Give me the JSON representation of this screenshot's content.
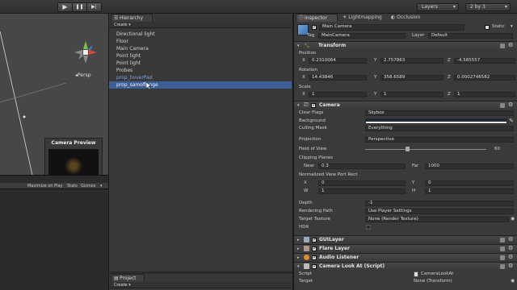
{
  "toolbar": {
    "play": "▶",
    "pause": "❚❚",
    "step": "▶|",
    "layers": "Layers",
    "layout": "2 by 3"
  },
  "scene": {
    "persp": "Persp",
    "camera_preview_title": "Camera Preview"
  },
  "game": {
    "maximize": "Maximize on Play",
    "stats": "Stats",
    "gizmos": "Gizmos"
  },
  "hierarchy": {
    "tab": "Hierarchy",
    "create": "Create",
    "items": [
      {
        "label": "Directional light"
      },
      {
        "label": "Floor"
      },
      {
        "label": "Main Camera"
      },
      {
        "label": "Point light"
      },
      {
        "label": "Point light"
      },
      {
        "label": "Probes"
      },
      {
        "label": "prop_hoverPad"
      },
      {
        "label": "prop_samoflange"
      }
    ]
  },
  "project": {
    "tab": "Project",
    "create": "Create"
  },
  "inspector": {
    "tabs": [
      "Inspector",
      "Lightmapping",
      "Occlusion"
    ],
    "object_name": "Main Camera",
    "static": "Static",
    "tag_label": "Tag",
    "tag_value": "MainCamera",
    "layer_label": "Layer",
    "layer_value": "Default",
    "transform": {
      "title": "Transform",
      "position": "Position",
      "rotation": "Rotation",
      "scale": "Scale",
      "pos": {
        "x": "0.2310064",
        "y": "2.757863",
        "z": "-4.585557"
      },
      "rot": {
        "x": "14.43846",
        "y": "358.6589",
        "z": "0.0002746582"
      },
      "scl": {
        "x": "1",
        "y": "1",
        "z": "1"
      },
      "x": "X",
      "y": "Y",
      "z": "Z"
    },
    "camera": {
      "title": "Camera",
      "clear_flags": "Clear Flags",
      "clear_flags_value": "Skybox",
      "background": "Background",
      "culling_mask": "Culling Mask",
      "culling_mask_value": "Everything",
      "projection": "Projection",
      "projection_value": "Perspective",
      "fov": "Field of View",
      "fov_value": "60",
      "clipping": "Clipping Planes",
      "near": "Near",
      "near_value": "0.3",
      "far": "Far",
      "far_value": "1000",
      "viewport": "Normalized View Port Rect",
      "vp_x": "0",
      "vp_y": "0",
      "vp_w": "1",
      "vp_h": "1",
      "w": "W",
      "h": "H",
      "depth": "Depth",
      "depth_value": "-1",
      "rendering_path": "Rendering Path",
      "rendering_path_value": "Use Player Settings",
      "target_texture": "Target Texture",
      "target_texture_value": "None (Render Texture)",
      "hdr": "HDR"
    },
    "components": [
      "GUILayer",
      "Flare Layer",
      "Audio Listener",
      "Camera Look At (Script)"
    ],
    "script": {
      "script_label": "Script",
      "script_value": "CameraLookAt",
      "target_label": "Target",
      "target_value": "None (Transform)"
    }
  }
}
